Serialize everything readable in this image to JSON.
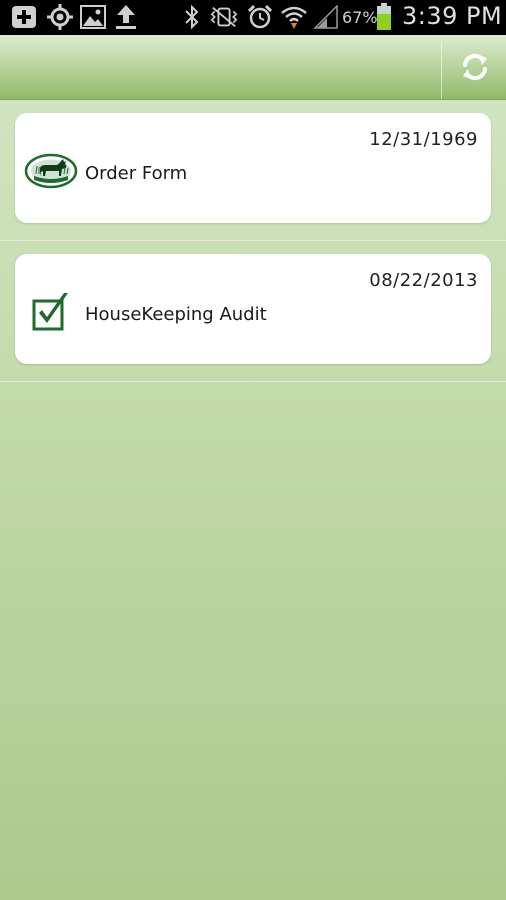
{
  "status_bar": {
    "battery_percent": "67%",
    "time": "3:39 PM",
    "icons": [
      "add-icon",
      "gps-icon",
      "gallery-icon",
      "upload-icon",
      "bluetooth-icon",
      "mute-icon",
      "alarm-icon",
      "wifi-icon",
      "signal-icon",
      "battery-icon"
    ]
  },
  "action_bar": {
    "refresh_icon": "refresh-icon"
  },
  "forms": [
    {
      "title": "Order Form",
      "date": "12/31/1969",
      "icon": "bull-logo-icon"
    },
    {
      "title": "HouseKeeping Audit",
      "date": "08/22/2013",
      "icon": "checkbox-checked-icon"
    }
  ],
  "colors": {
    "accent_green": "#1f6b2d",
    "action_bar_bottom": "#8fba6a",
    "background": "#c4dcad"
  }
}
